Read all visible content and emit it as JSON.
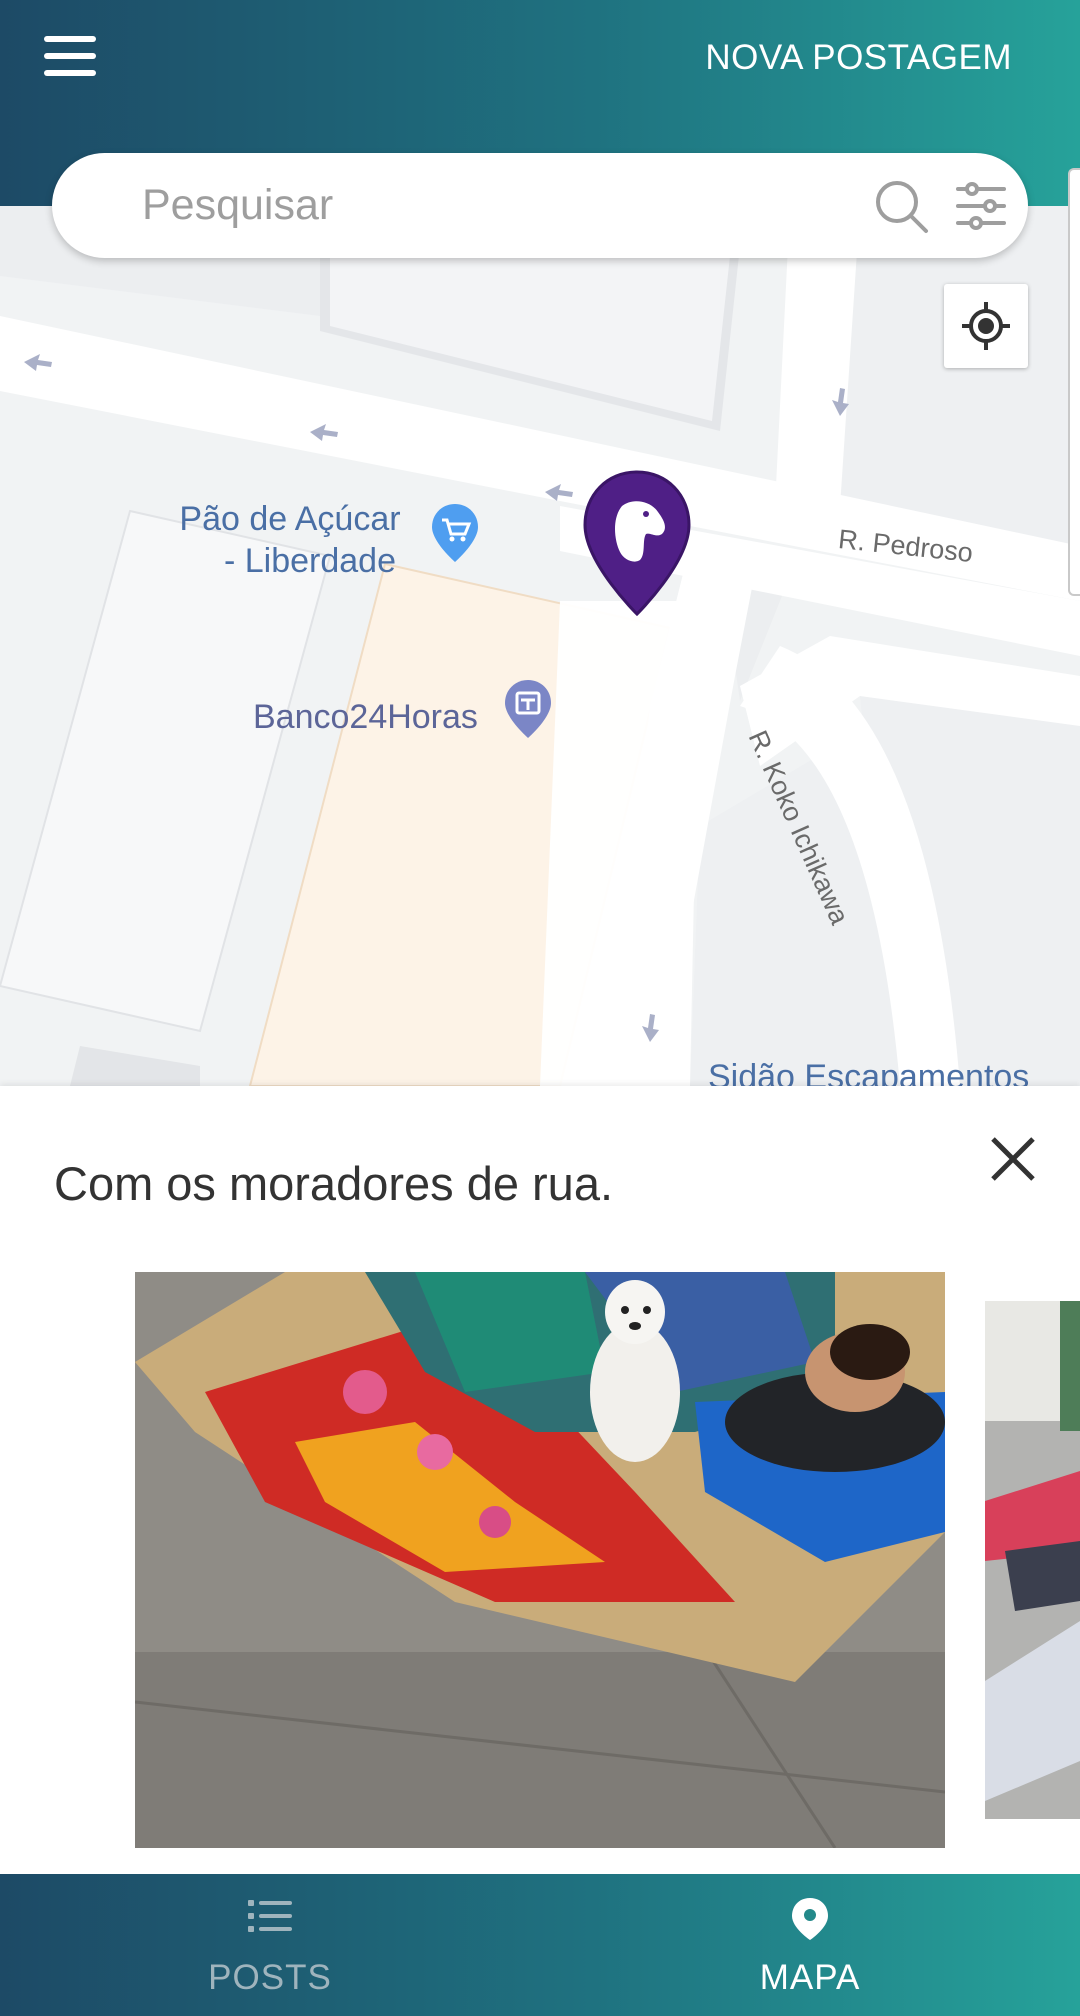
{
  "header": {
    "new_post_label": "NOVA POSTAGEM",
    "menu_icon": "hamburger-menu-icon"
  },
  "search": {
    "placeholder": "Pesquisar",
    "value": "",
    "search_icon": "search-icon",
    "filter_icon": "filter-sliders-icon"
  },
  "map": {
    "locate_icon": "my-location-icon",
    "labels": {
      "poi_supermarket": "Pão de Açúcar",
      "poi_supermarket_line2": "- Liberdade",
      "poi_atm": "Banco24Horas",
      "street_pedroso": "R. Pedroso",
      "street_koko": "R. Koko Ichikawa",
      "poi_bottom": "Sidão Escapamentos"
    },
    "marker_icon": "dog-marker-icon"
  },
  "post": {
    "title": "Com os moradores de rua.",
    "close_icon": "close-icon"
  },
  "nav": {
    "items": [
      {
        "label": "POSTS",
        "icon": "list-icon",
        "active": false
      },
      {
        "label": "MAPA",
        "icon": "location-pin-icon",
        "active": true
      }
    ]
  },
  "colors": {
    "header_gradient_start": "#1d4a66",
    "header_gradient_end": "#26a29a",
    "marker": "#4f1f86",
    "nav_inactive": "#9fb4bd",
    "nav_active": "#ffffff"
  }
}
